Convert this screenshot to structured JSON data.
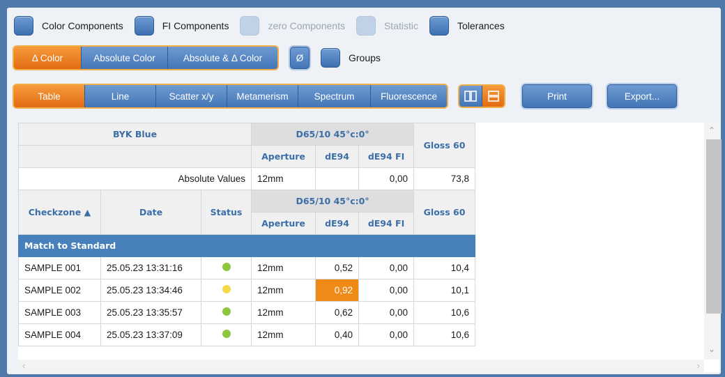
{
  "checkboxes": [
    {
      "label": "Color Components",
      "enabled": true
    },
    {
      "label": "FI Components",
      "enabled": true
    },
    {
      "label": "zero Components",
      "enabled": false
    },
    {
      "label": "Statistic",
      "enabled": false
    },
    {
      "label": "Tolerances",
      "enabled": true
    }
  ],
  "color_mode": {
    "options": [
      "Δ Color",
      "Absolute Color",
      "Absolute & Δ Color"
    ],
    "selected": "Δ Color"
  },
  "average_button": "Ø",
  "groups_checkbox": {
    "label": "Groups"
  },
  "view_mode": {
    "options": [
      "Table",
      "Line",
      "Scatter x/y",
      "Metamerism",
      "Spectrum",
      "Fluorescence"
    ],
    "selected": "Table"
  },
  "layout_toggle": {
    "selected": "horizontal-split"
  },
  "print_label": "Print",
  "export_label": "Export...",
  "colors": {
    "accent_orange": "#e8781c",
    "button_blue": "#4d7fbd",
    "group_header": "#4880bb",
    "pass_green": "#8cc63f",
    "warn_yellow": "#f5d949",
    "highlight_cell": "#ef8a16"
  },
  "table": {
    "standard_name": "BYK Blue",
    "illuminant": "D65/10 45°c:0°",
    "gloss_header": "Gloss 60",
    "sub_headers": [
      "Aperture",
      "dE94",
      "dE94 FI"
    ],
    "absolute_row": {
      "label": "Absolute Values",
      "aperture": "12mm",
      "de94": "",
      "de94_fi": "0,00",
      "gloss": "73,8"
    },
    "columns": {
      "checkzone": "Checkzone ▲",
      "date": "Date",
      "status": "Status"
    },
    "group_label": "Match to Standard",
    "rows": [
      {
        "checkzone": "SAMPLE 001",
        "date": "25.05.23 13:31:16",
        "status": "pass",
        "aperture": "12mm",
        "de94": "0,52",
        "de94_fi": "0,00",
        "gloss": "10,4"
      },
      {
        "checkzone": "SAMPLE 002",
        "date": "25.05.23 13:34:46",
        "status": "warn",
        "aperture": "12mm",
        "de94": "0,92",
        "de94_fi": "0,00",
        "gloss": "10,1"
      },
      {
        "checkzone": "SAMPLE 003",
        "date": "25.05.23 13:35:57",
        "status": "pass",
        "aperture": "12mm",
        "de94": "0,62",
        "de94_fi": "0,00",
        "gloss": "10,6"
      },
      {
        "checkzone": "SAMPLE 004",
        "date": "25.05.23 13:37:09",
        "status": "pass",
        "aperture": "12mm",
        "de94": "0,40",
        "de94_fi": "0,00",
        "gloss": "10,6"
      }
    ]
  }
}
